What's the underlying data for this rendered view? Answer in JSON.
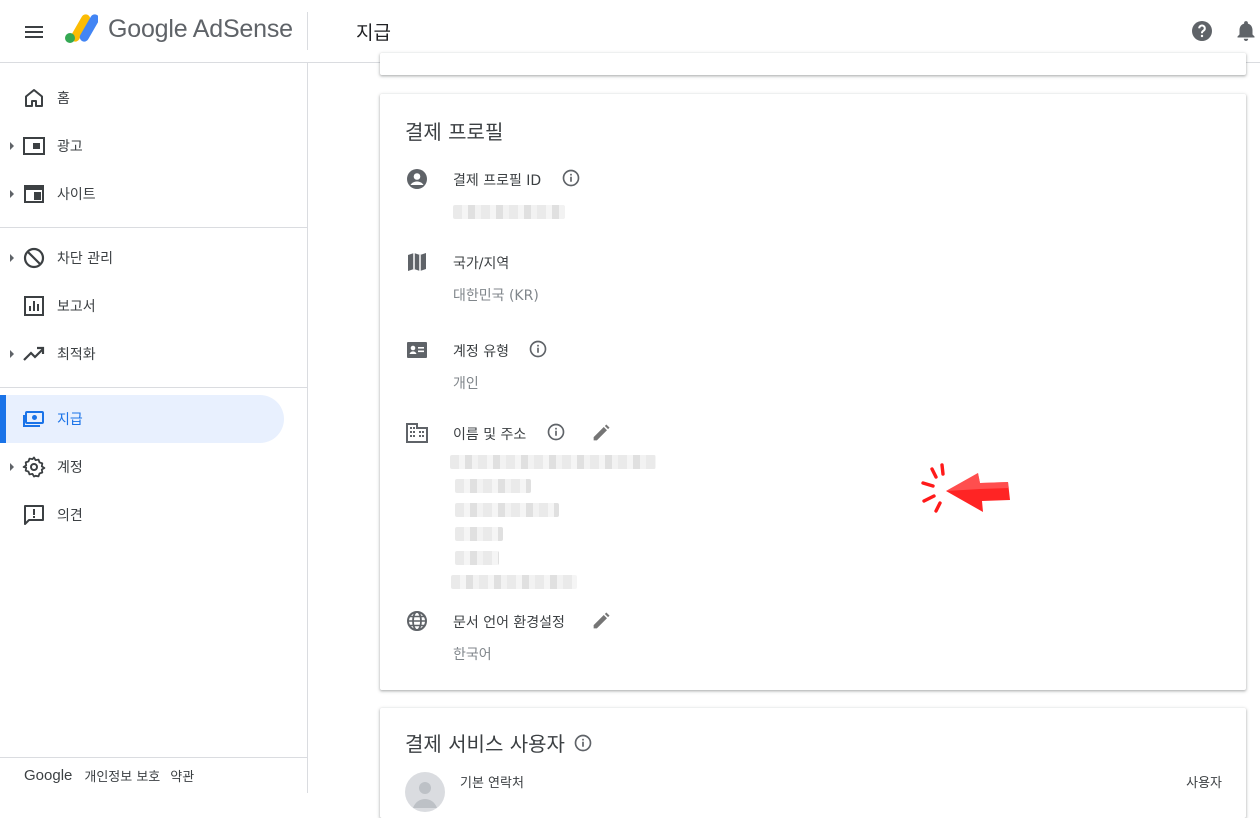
{
  "header": {
    "product_name": "Google AdSense",
    "page_title": "지급"
  },
  "sidebar": {
    "items": [
      {
        "label": "홈",
        "icon": "home-icon"
      },
      {
        "label": "광고",
        "icon": "ads-icon"
      },
      {
        "label": "사이트",
        "icon": "sites-icon"
      },
      {
        "label": "차단 관리",
        "icon": "block-icon"
      },
      {
        "label": "보고서",
        "icon": "reports-icon"
      },
      {
        "label": "최적화",
        "icon": "trending-icon"
      },
      {
        "label": "지급",
        "icon": "payments-icon",
        "active": true
      },
      {
        "label": "계정",
        "icon": "settings-icon"
      },
      {
        "label": "의견",
        "icon": "feedback-icon"
      }
    ],
    "footer": {
      "brand": "Google",
      "privacy": "개인정보 보호",
      "terms": "약관"
    }
  },
  "payment_profile": {
    "title": "결제 프로필",
    "profile_id": {
      "label": "결제 프로필 ID"
    },
    "country": {
      "label": "국가/지역",
      "value": "대한민국 (KR)"
    },
    "account_type": {
      "label": "계정 유형",
      "value": "개인"
    },
    "name_address": {
      "label": "이름 및 주소"
    },
    "doc_language": {
      "label": "문서 언어 환경설정",
      "value": "한국어"
    }
  },
  "payment_users": {
    "title": "결제 서비스 사용자",
    "primary_contact": "기본 연락처",
    "role": "사용자"
  },
  "colors": {
    "accent": "#1a73e8",
    "active_bg": "#e8f0fe",
    "annotation_red": "#ff1a1a"
  }
}
